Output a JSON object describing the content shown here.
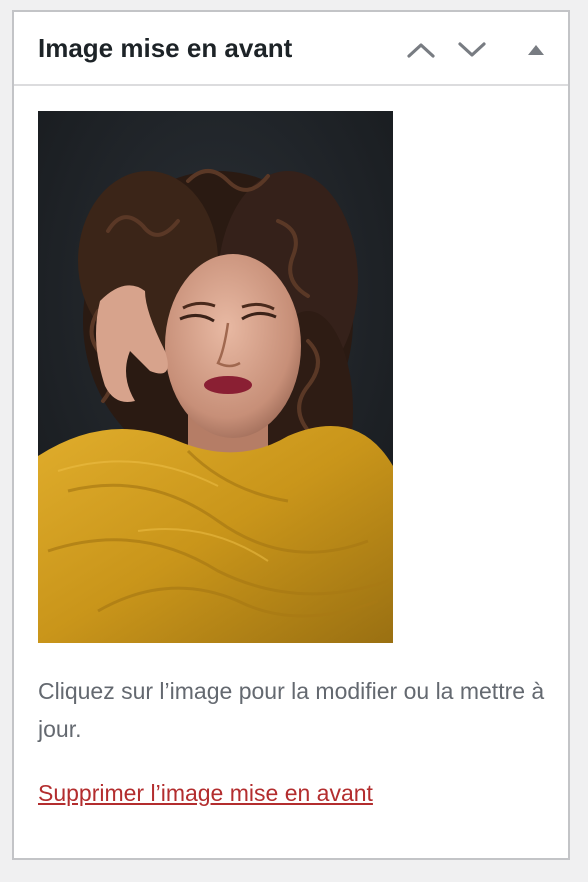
{
  "panel": {
    "title": "Image mise en avant",
    "move_up_icon": "chevron-up-icon",
    "move_down_icon": "chevron-down-icon",
    "toggle_icon": "triangle-up-icon"
  },
  "featured_image": {
    "help_text": "Cliquez sur l’image pour la modifier ou la mettre à jour.",
    "remove_label": "Supprimer l’image mise en avant"
  },
  "colors": {
    "panel_border": "#c3c4c7",
    "title": "#1d2327",
    "icon": "#787c82",
    "help_text": "#646970",
    "remove_link": "#b32d2e",
    "photo_background": "#1c2024",
    "scarf": "#c9951a"
  }
}
